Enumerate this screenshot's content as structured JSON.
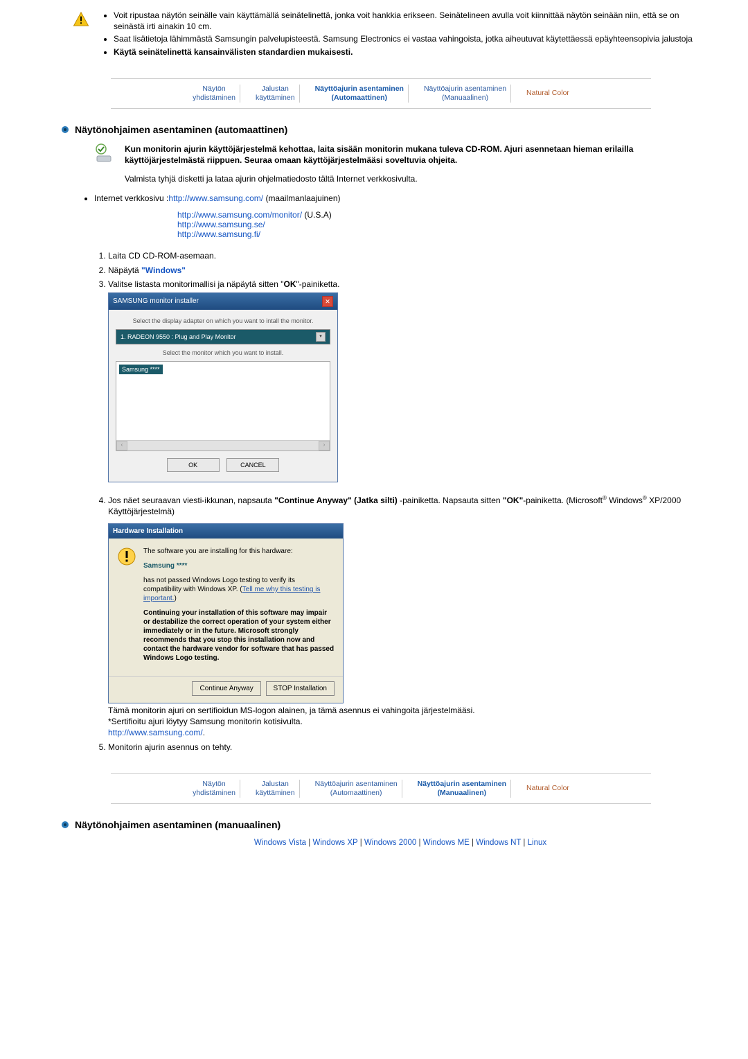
{
  "warn": {
    "li1": "Voit ripustaa näytön seinälle vain käyttämällä seinätelinettä, jonka voit hankkia erikseen. Seinätelineen avulla voit kiinnittää näytön seinään niin, että se on seinästä irti ainakin 10 cm.",
    "li2": "Saat lisätietoja lähimmästä Samsungin palvelupisteestä. Samsung Electronics ei vastaa vahingoista, jotka aiheutuvat käytettäessä epäyhteensopivia jalustoja",
    "li3": "Käytä seinätelinettä kansainvälisten standardien mukaisesti."
  },
  "tabs": {
    "t1a": "Näytön",
    "t1b": "yhdistäminen",
    "t2a": "Jalustan",
    "t2b": "käyttäminen",
    "t3a": "Näyttöajurin asentaminen",
    "t3b": "(Automaattinen)",
    "t4a": "Näyttöajurin asentaminen",
    "t4b": "(Manuaalinen)",
    "t5": "Natural Color"
  },
  "auto": {
    "heading": "Näytönohjaimen asentaminen (automaattinen)",
    "note": "Kun monitorin ajurin käyttöjärjestelmä kehottaa, laita sisään monitorin mukana tuleva CD-ROM. Ajuri asennetaan hieman erilailla käyttöjärjestelmästä riippuen. Seuraa omaan käyttöjärjestelmääsi soveltuvia ohjeita.",
    "valmista": "Valmista tyhjä disketti ja lataa ajurin ohjelmatiedosto tältä Internet verkkosivulta.",
    "inetLabel": "Internet verkkosivu :",
    "url1": "http://www.samsung.com/",
    "url1suffix": " (maailmanlaajuinen)",
    "url2": "http://www.samsung.com/monitor/",
    "url2suffix": " (U.S.A)",
    "url3": "http://www.samsung.se/",
    "url4": "http://www.samsung.fi/"
  },
  "steps": {
    "s1": "Laita CD CD-ROM-asemaan.",
    "s2a": "Näpäytä ",
    "s2b": "\"Windows\"",
    "s3a": "Valitse listasta monitorimallisi ja näpäytä sitten \"",
    "s3b": "OK",
    "s3c": "\"-painiketta."
  },
  "dlg": {
    "title": "SAMSUNG monitor installer",
    "lbl1": "Select the display adapter on which you want to intall the monitor.",
    "field": "1. RADEON 9550 : Plug and Play Monitor",
    "lbl2": "Select the monitor which you want to install.",
    "item": "Samsung ****",
    "ok": "OK",
    "cancel": "CANCEL"
  },
  "step4": {
    "a": "Jos näet seuraavan viesti-ikkunan, napsauta ",
    "b": "\"Continue Anyway\" (Jatka silti)",
    "c": " -painiketta. Napsauta sitten ",
    "d": "\"OK\"",
    "e": "-painiketta. (Microsoft",
    "f": " Windows",
    "g": " XP/2000 Käyttöjärjestelmä)"
  },
  "hw": {
    "title": "Hardware Installation",
    "p1": "The software you are installing for this hardware:",
    "samsung_item": "Samsung ****",
    "p2a": "has not passed Windows Logo testing to verify its compatibility with Windows XP. (",
    "p2link": "Tell me why this testing is important.",
    "p2b": ")",
    "p3": "Continuing your installation of this software may impair or destabilize the correct operation of your system either immediately or in the future. Microsoft strongly recommends that you stop this installation now and contact the hardware vendor for software that has passed Windows Logo testing.",
    "btn1": "Continue Anyway",
    "btn2": "STOP Installation"
  },
  "tama": {
    "l1": "Tämä monitorin ajuri on sertifioidun MS-logon alainen, ja tämä asennus ei vahingoita järjestelmääsi.",
    "l2": "*Sertifioitu ajuri löytyy Samsung monitorin kotisivulta.",
    "l3": "http://www.samsung.com/",
    "l3dot": "."
  },
  "step5": "Monitorin ajurin asennus on tehty.",
  "manual_heading": "Näytönohjaimen asentaminen (manuaalinen)",
  "os": {
    "vista": "Windows Vista",
    "xp": "Windows XP",
    "w2k": "Windows 2000",
    "me": "Windows ME",
    "nt": "Windows NT",
    "linux": "Linux"
  }
}
